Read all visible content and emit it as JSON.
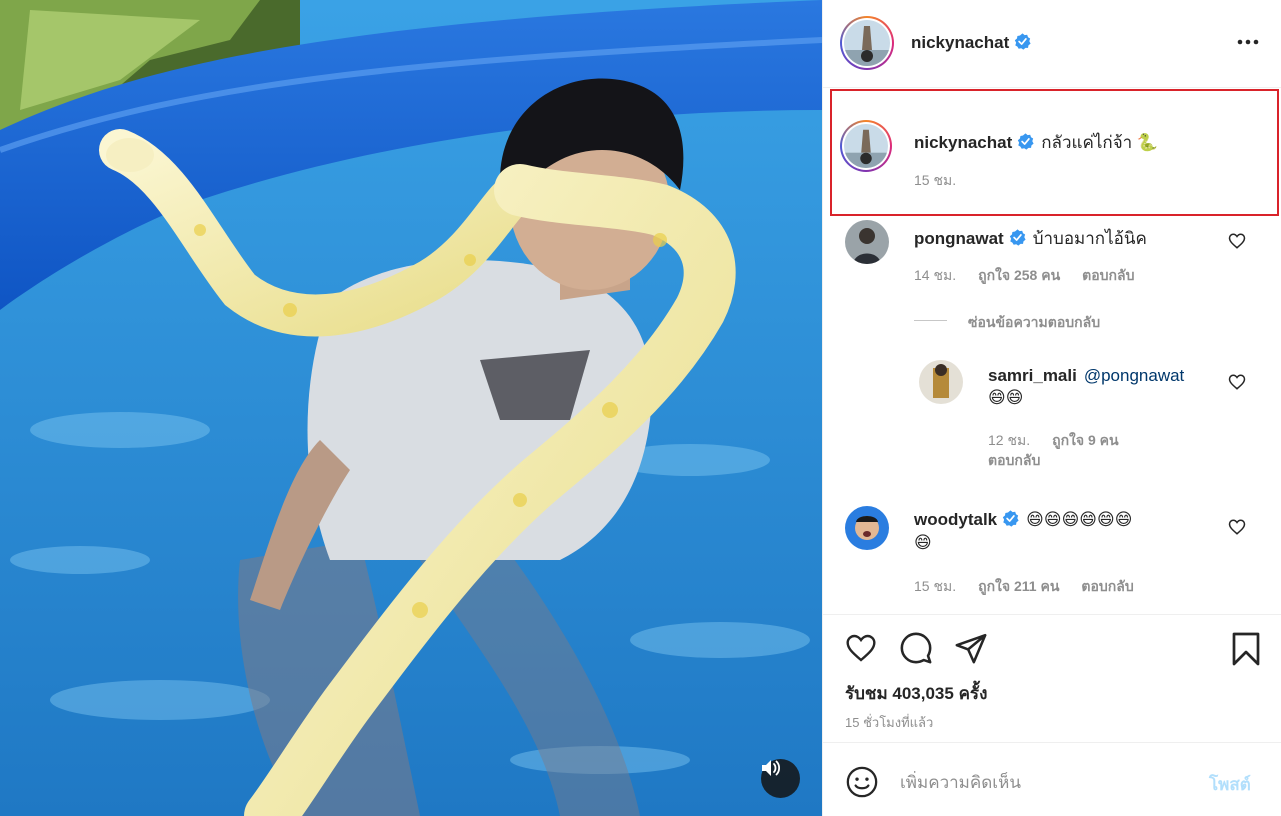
{
  "post": {
    "author": "nickynachat",
    "caption": {
      "username": "nickynachat",
      "text": "กลัวแค่ไก่จ้า 🐍",
      "time": "15 ชม."
    },
    "comments": [
      {
        "username": "pongnawat",
        "text": "บ้าบอมากไอ้นิค",
        "time": "14 ชม.",
        "likes": "ถูกใจ 258 คน",
        "reply": "ตอบกลับ",
        "hide_replies": "ซ่อนข้อความตอบกลับ",
        "replies": [
          {
            "username": "samri_mali",
            "mention": "@pongnawat",
            "text": "😄😄",
            "time": "12 ชม.",
            "likes": "ถูกใจ 9 คน",
            "reply": "ตอบกลับ"
          }
        ]
      },
      {
        "username": "woodytalk",
        "text_line1": "😄😄😄😄😄😄",
        "text_line2": "😄",
        "time": "15 ชม.",
        "likes": "ถูกใจ 211 คน",
        "reply": "ตอบกลับ"
      }
    ],
    "views": "รับชม 403,035 ครั้ง",
    "posted": "15 ชั่วโมงที่แล้ว",
    "comment_placeholder": "เพิ่มความคิดเห็น",
    "post_label": "โพสต์"
  },
  "icons": {
    "more": "more-options-icon",
    "like": "heart-icon",
    "comment": "comment-icon",
    "share": "share-icon",
    "save": "bookmark-icon",
    "emoji": "emoji-icon",
    "sound": "speaker-icon",
    "verified": "verified-badge-icon"
  },
  "colors": {
    "verified": "#3897f0",
    "highlight_box": "#d9232a",
    "post_button": "#b2dffc",
    "muted_text": "#8e8e8e",
    "mention": "#00376b"
  }
}
